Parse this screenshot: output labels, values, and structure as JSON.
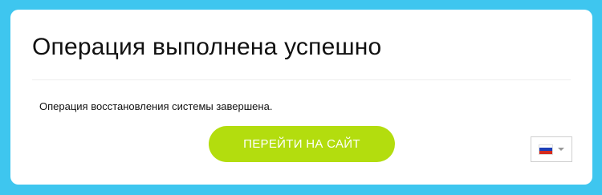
{
  "dialog": {
    "title": "Операция выполнена успешно",
    "message": "Операция восстановления системы завершена.",
    "button_label": "ПЕРЕЙТИ НА САЙТ"
  },
  "language_selector": {
    "flag_icon": "russia-flag-icon",
    "dropdown_icon": "caret-down-icon"
  },
  "colors": {
    "background": "#3ec6ef",
    "button": "#b3dd0e",
    "button_text": "#ffffff"
  }
}
